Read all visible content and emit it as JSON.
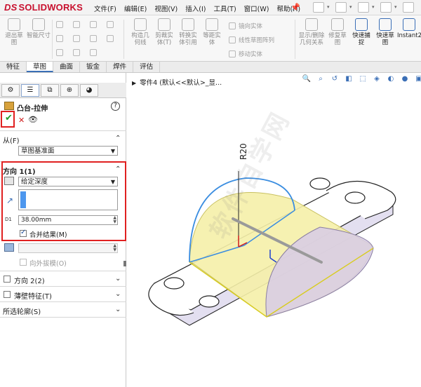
{
  "app": {
    "logo": "SOLIDWORKS",
    "logo_mark": "DS"
  },
  "menu": [
    "文件(F)",
    "编辑(E)",
    "视图(V)",
    "插入(I)",
    "工具(T)",
    "窗口(W)",
    "帮助(H)"
  ],
  "ribbon": {
    "exit_sketch": "退出草图",
    "smart_dim": "智能尺寸",
    "construct_geom": "构造几何线",
    "cut_entities": "剪裁实体(T)",
    "convert_entities": "转换实体引用",
    "offset_entities": "等距实体",
    "mirror_entities": "镜向实体",
    "linear_pattern": "线性草图阵列",
    "move_entities": "移动实体",
    "show_relations": "显示/删除几何关系",
    "repair_sketch": "修复草图",
    "quick_snaps": "快速捕捉",
    "rapid_sketch": "快速草图",
    "instant2d": "Instant2D"
  },
  "command_tabs": [
    "特征",
    "草图",
    "曲面",
    "钣金",
    "焊件",
    "评估"
  ],
  "panel": {
    "feature_title": "凸台-拉伸",
    "ok": "✔",
    "cancel": "✕",
    "preview": "👁",
    "help": "?",
    "from_label": "从(F)",
    "from_value": "草图基准面",
    "dir1_label": "方向 1(1)",
    "end_condition": "给定深度",
    "depth": "38.00mm",
    "merge_label": "合并结果(M)",
    "draft_label": "向外拔模(O)",
    "dir2_label": "方向 2(2)",
    "thin_label": "薄壁特征(T)",
    "contours_label": "所选轮廓(S)"
  },
  "viewport": {
    "tree_item": "零件4 (默认<<默认>_显...",
    "dimension": "R20",
    "watermark": "软件自学网"
  },
  "colors": {
    "accent": "#3b6fb6",
    "highlight": "#e02020",
    "preview_yellow": "#f5f0a8"
  }
}
